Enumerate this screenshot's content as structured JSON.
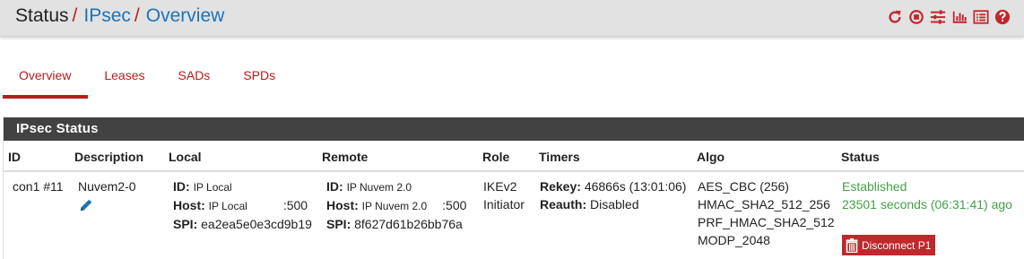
{
  "breadcrumb": {
    "status": "Status",
    "sep1": "/",
    "ipsec": "IPsec",
    "sep2": "/",
    "overview": "Overview"
  },
  "header_icons": [
    "reload-icon",
    "stop-icon",
    "sliders-icon",
    "chart-icon",
    "list-icon",
    "help-icon"
  ],
  "tabs": [
    {
      "label": "Overview",
      "active": true
    },
    {
      "label": "Leases",
      "active": false
    },
    {
      "label": "SADs",
      "active": false
    },
    {
      "label": "SPDs",
      "active": false
    }
  ],
  "panel": {
    "title": "IPsec Status",
    "columns": [
      "ID",
      "Description",
      "Local",
      "Remote",
      "Role",
      "Timers",
      "Algo",
      "Status"
    ],
    "rows": [
      {
        "id": "con1 #11",
        "description": "Nuvem2-0",
        "local": {
          "id_label": "ID:",
          "id": "IP Local",
          "host_label": "Host:",
          "host": "IP Local",
          "port": ":500",
          "spi_label": "SPI:",
          "spi": "ea2ea5e0e3cd9b19"
        },
        "remote": {
          "id_label": "ID:",
          "id": "IP Nuvem 2.0",
          "host_label": "Host:",
          "host": "IP Nuvem 2.0",
          "port": ":500",
          "spi_label": "SPI:",
          "spi": "8f627d61b26bb76a"
        },
        "role": {
          "version": "IKEv2",
          "type": "Initiator"
        },
        "timers": {
          "rekey_label": "Rekey:",
          "rekey": "46866s (13:01:06)",
          "reauth_label": "Reauth:",
          "reauth": "Disabled"
        },
        "algo": [
          "AES_CBC (256)",
          "HMAC_SHA2_512_256",
          "PRF_HMAC_SHA2_512",
          "MODP_2048"
        ],
        "status": {
          "state": "Established",
          "duration": "23501 seconds (06:31:41) ago",
          "disconnect_label": "Disconnect P1"
        }
      }
    ]
  },
  "colors": {
    "accent": "#b71c1c",
    "link": "#1e73b8",
    "established": "#43a047",
    "panel_header": "#424242",
    "button": "#c0282c"
  }
}
